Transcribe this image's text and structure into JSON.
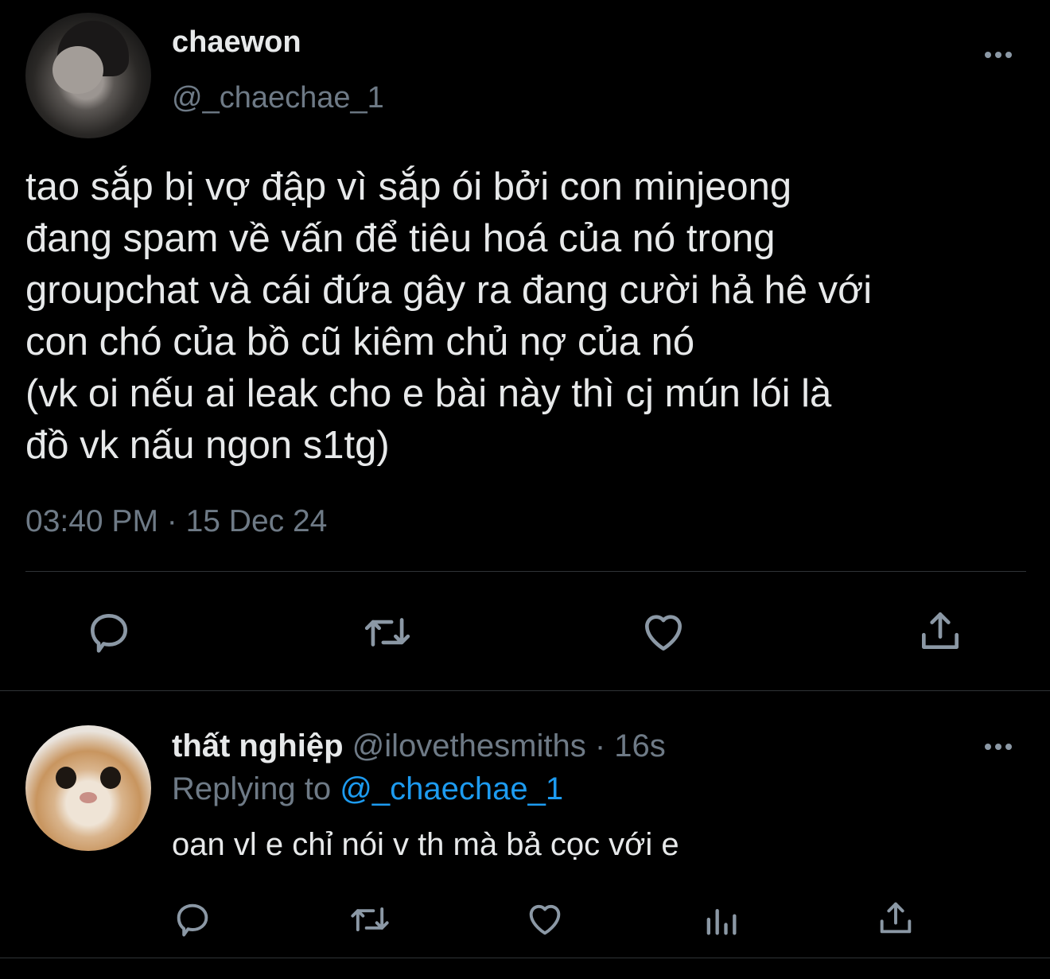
{
  "tweet": {
    "display_name": "chaewon",
    "handle": "@_chaechae_1",
    "text_lines": [
      "tao sắp bị vợ đập vì sắp ói bởi con minjeong",
      "đang spam về vấn để tiêu hoá của nó trong",
      "groupchat và cái đứa gây ra đang cười hả hê với",
      "con chó của bồ cũ kiêm chủ nợ của nó",
      "(vk oi nếu ai leak cho e bài này thì cj mún lói là",
      "đồ vk nấu ngon s1tg)"
    ],
    "timestamp": "03:40 PM · 15 Dec 24",
    "actions": [
      "reply-icon",
      "retweet-icon",
      "like-icon",
      "share-icon"
    ]
  },
  "reply": {
    "display_name": "thất nghiệp",
    "handle": "@ilovethesmiths",
    "separator": "·",
    "age": "16s",
    "replying_prefix": "Replying to",
    "replying_to": "@_chaechae_1",
    "text": "oan vl e chỉ nói v th mà bả cọc với e",
    "actions": [
      "reply-icon",
      "retweet-icon",
      "like-icon",
      "analytics-icon",
      "share-icon"
    ]
  },
  "colors": {
    "background": "#000000",
    "text": "#e7e9ea",
    "muted": "#6e7a86",
    "link": "#1d9bf0",
    "icon": "#8b98a5",
    "divider": "#2f3336"
  }
}
